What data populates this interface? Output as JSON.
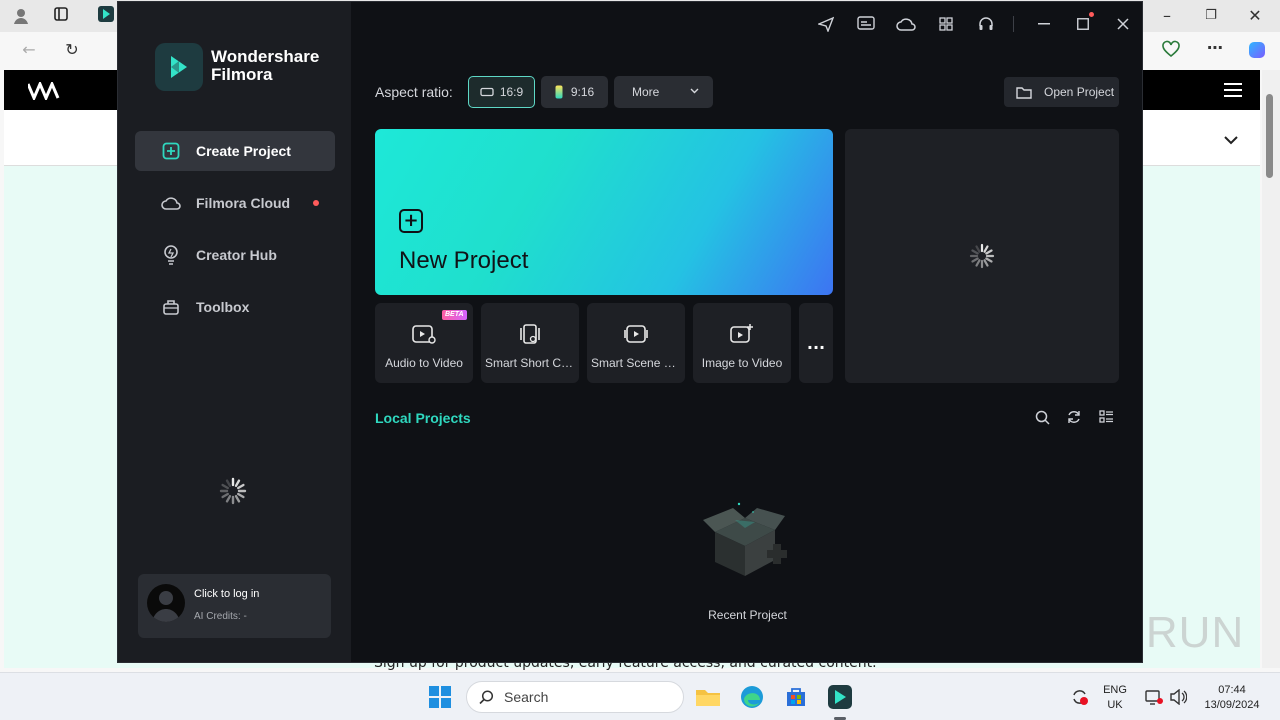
{
  "filmora": {
    "brand_line1": "Wondershare",
    "brand_line2": "Filmora",
    "nav": [
      {
        "label": "Create Project",
        "icon": "plus-square-icon",
        "active": true
      },
      {
        "label": "Filmora Cloud",
        "icon": "cloud-icon",
        "notification": true
      },
      {
        "label": "Creator Hub",
        "icon": "lightbulb-icon"
      },
      {
        "label": "Toolbox",
        "icon": "toolbox-icon"
      }
    ],
    "login": {
      "title": "Click to log in",
      "subtitle": "AI Credits: -"
    },
    "aspect": {
      "label": "Aspect ratio:",
      "options": [
        "16:9",
        "9:16"
      ],
      "selected": "16:9",
      "more": "More"
    },
    "open_project": "Open Project",
    "new_project": "New Project",
    "tools": [
      {
        "label": "Audio to Video",
        "badge": "BETA"
      },
      {
        "label": "Smart Short Cli..."
      },
      {
        "label": "Smart Scene Cut"
      },
      {
        "label": "Image to Video"
      }
    ],
    "more_tools": "...",
    "local_projects": "Local Projects",
    "empty_state": "Recent Project"
  },
  "taskbar": {
    "search_placeholder": "Search",
    "lang_line1": "ENG",
    "lang_line2": "UK",
    "time": "07:44",
    "date": "13/09/2024"
  },
  "browser": {
    "partial_text": "Sign up for product updates, early feature access, and curated content."
  },
  "watermark": "ANY RUN",
  "colors": {
    "accent": "#2fd8bf",
    "new_project_gradient_start": "#1ee8d8",
    "new_project_gradient_end": "#3d74f2",
    "sidebar_bg": "#1b1d22",
    "main_bg": "#0f1115",
    "notification_dot": "#ff5b5b"
  }
}
